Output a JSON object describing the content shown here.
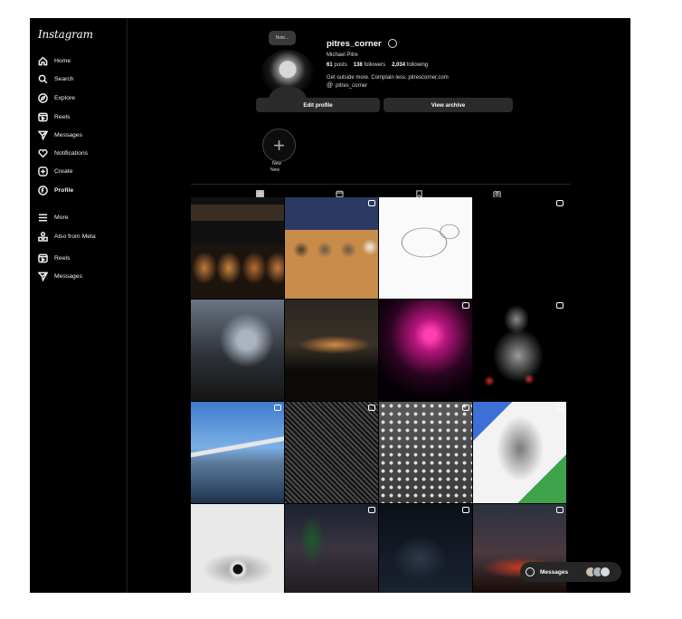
{
  "app": {
    "logo": "Instagram"
  },
  "sidebar": {
    "items": [
      {
        "label": "Home",
        "icon": "home-icon"
      },
      {
        "label": "Search",
        "icon": "search-icon"
      },
      {
        "label": "Explore",
        "icon": "compass-icon"
      },
      {
        "label": "Reels",
        "icon": "reels-icon"
      },
      {
        "label": "Messages",
        "icon": "send-icon"
      },
      {
        "label": "Notifications",
        "icon": "heart-icon"
      },
      {
        "label": "Create",
        "icon": "plus-square-icon"
      },
      {
        "label": "Profile",
        "icon": "avatar-icon"
      },
      {
        "label": "More",
        "icon": "menu-icon"
      },
      {
        "label": "Also from Meta",
        "icon": "meta-apps-icon"
      },
      {
        "label": "Reels",
        "icon": "reels-icon"
      },
      {
        "label": "Messages",
        "icon": "send-icon"
      }
    ]
  },
  "profile": {
    "note": "Note...",
    "username": "pitres_corner",
    "full_name": "Michael Pitre",
    "posts_count": "61",
    "posts_label": "posts",
    "followers_count": "138",
    "followers_label": "followers",
    "following_count": "2,034",
    "following_label": "following",
    "bio": "Get outside more. Complain less. pitrescorner.com",
    "threads_handle": "pitres_corner",
    "edit_button": "Edit profile",
    "archive_button": "View archive",
    "highlight_new_1": "New",
    "highlight_new_2": "New"
  },
  "tabs": [
    {
      "icon": "grid-icon",
      "active": true
    },
    {
      "icon": "reels-icon",
      "active": false
    },
    {
      "icon": "bookmark-icon",
      "active": false
    },
    {
      "icon": "tagged-icon",
      "active": false
    }
  ],
  "messages_pill": {
    "label": "Messages"
  }
}
